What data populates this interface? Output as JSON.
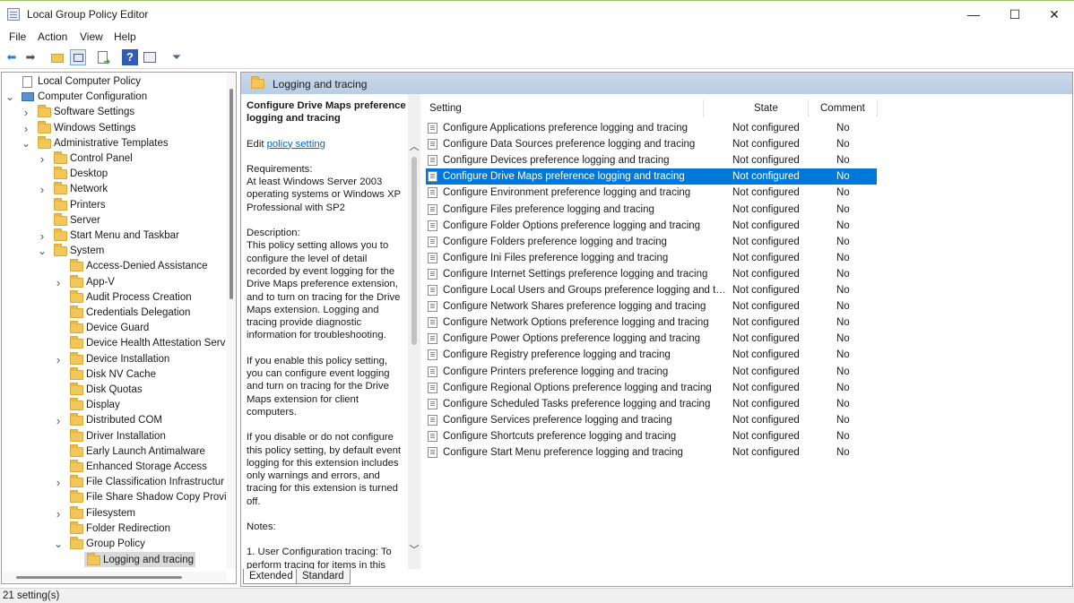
{
  "window": {
    "title": "Local Group Policy Editor",
    "minimize": "—",
    "maximize": "☐",
    "close": "✕"
  },
  "menu": [
    "File",
    "Action",
    "View",
    "Help"
  ],
  "toolbar_icons": [
    "back-arrow-icon",
    "forward-arrow-icon",
    "up-folder-icon",
    "show-hide-tree-icon",
    "export-list-icon",
    "help-icon",
    "properties-icon",
    "filter-icon"
  ],
  "tree": [
    {
      "label": "Local Computer Policy"
    },
    {
      "label": "Computer Configuration"
    },
    {
      "label": "Software Settings"
    },
    {
      "label": "Windows Settings"
    },
    {
      "label": "Administrative Templates"
    },
    {
      "label": "Control Panel"
    },
    {
      "label": "Desktop"
    },
    {
      "label": "Network"
    },
    {
      "label": "Printers"
    },
    {
      "label": "Server"
    },
    {
      "label": "Start Menu and Taskbar"
    },
    {
      "label": "System"
    },
    {
      "label": "Access-Denied Assistance"
    },
    {
      "label": "App-V"
    },
    {
      "label": "Audit Process Creation"
    },
    {
      "label": "Credentials Delegation"
    },
    {
      "label": "Device Guard"
    },
    {
      "label": "Device Health Attestation Serv"
    },
    {
      "label": "Device Installation"
    },
    {
      "label": "Disk NV Cache"
    },
    {
      "label": "Disk Quotas"
    },
    {
      "label": "Display"
    },
    {
      "label": "Distributed COM"
    },
    {
      "label": "Driver Installation"
    },
    {
      "label": "Early Launch Antimalware"
    },
    {
      "label": "Enhanced Storage Access"
    },
    {
      "label": "File Classification Infrastructur"
    },
    {
      "label": "File Share Shadow Copy Provic"
    },
    {
      "label": "Filesystem"
    },
    {
      "label": "Folder Redirection"
    },
    {
      "label": "Group Policy"
    },
    {
      "label": "Logging and tracing"
    }
  ],
  "header": {
    "title": "Logging and tracing"
  },
  "description": {
    "title": "Configure Drive Maps preference logging and tracing",
    "edit_prefix": "Edit",
    "edit_link": "policy setting",
    "requirements_label": "Requirements:",
    "requirements": "At least Windows Server 2003 operating systems or Windows XP Professional with SP2",
    "description_label": "Description:",
    "description": "This policy setting allows you to configure the level of detail recorded by event logging for the Drive Maps preference extension, and to turn on tracing for the Drive Maps extension. Logging and tracing provide diagnostic information for troubleshooting.",
    "enable": "If you enable this policy setting, you can configure event logging and turn on tracing for the Drive Maps extension for client computers.",
    "disable": "If you disable or do not configure this policy setting, by default event logging for this extension includes only warnings and errors, and tracing for this extension is turned off.",
    "notes_label": "Notes:",
    "note1": "1. User Configuration tracing: To perform tracing for items in this"
  },
  "columns": {
    "setting": "Setting",
    "state": "State",
    "comment": "Comment"
  },
  "rows": [
    {
      "setting": "Configure Applications preference logging and tracing",
      "state": "Not configured",
      "comment": "No"
    },
    {
      "setting": "Configure Data Sources preference logging and tracing",
      "state": "Not configured",
      "comment": "No"
    },
    {
      "setting": "Configure Devices preference logging and tracing",
      "state": "Not configured",
      "comment": "No"
    },
    {
      "setting": "Configure Drive Maps preference logging and tracing",
      "state": "Not configured",
      "comment": "No"
    },
    {
      "setting": "Configure Environment preference logging and tracing",
      "state": "Not configured",
      "comment": "No"
    },
    {
      "setting": "Configure Files preference logging and tracing",
      "state": "Not configured",
      "comment": "No"
    },
    {
      "setting": "Configure Folder Options preference logging and tracing",
      "state": "Not configured",
      "comment": "No"
    },
    {
      "setting": "Configure Folders preference logging and tracing",
      "state": "Not configured",
      "comment": "No"
    },
    {
      "setting": "Configure Ini Files preference logging and tracing",
      "state": "Not configured",
      "comment": "No"
    },
    {
      "setting": "Configure Internet Settings preference logging and tracing",
      "state": "Not configured",
      "comment": "No"
    },
    {
      "setting": "Configure Local Users and Groups preference logging and tra...",
      "state": "Not configured",
      "comment": "No"
    },
    {
      "setting": "Configure Network Shares preference logging and tracing",
      "state": "Not configured",
      "comment": "No"
    },
    {
      "setting": "Configure Network Options preference logging and tracing",
      "state": "Not configured",
      "comment": "No"
    },
    {
      "setting": "Configure Power Options preference logging and tracing",
      "state": "Not configured",
      "comment": "No"
    },
    {
      "setting": "Configure Registry preference logging and tracing",
      "state": "Not configured",
      "comment": "No"
    },
    {
      "setting": "Configure Printers preference logging and tracing",
      "state": "Not configured",
      "comment": "No"
    },
    {
      "setting": "Configure Regional Options preference logging and tracing",
      "state": "Not configured",
      "comment": "No"
    },
    {
      "setting": "Configure Scheduled Tasks preference logging and tracing",
      "state": "Not configured",
      "comment": "No"
    },
    {
      "setting": "Configure Services preference logging and tracing",
      "state": "Not configured",
      "comment": "No"
    },
    {
      "setting": "Configure Shortcuts preference logging and tracing",
      "state": "Not configured",
      "comment": "No"
    },
    {
      "setting": "Configure Start Menu preference logging and tracing",
      "state": "Not configured",
      "comment": "No"
    }
  ],
  "selected_row": 3,
  "tabs": [
    "Extended",
    "Standard"
  ],
  "status": "21 setting(s)",
  "colors": {
    "selection": "#0078d7",
    "header_band": "#c4d5ea",
    "folder": "#f1c75b"
  }
}
